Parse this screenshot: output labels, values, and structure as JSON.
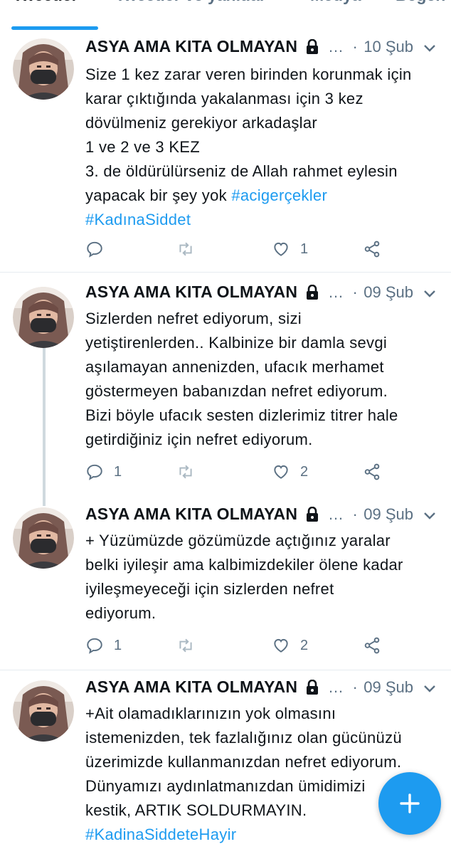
{
  "tabs": [
    {
      "label": "Tweetler",
      "active": true
    },
    {
      "label": "Tweetler ve yanıtlar",
      "active": false
    },
    {
      "label": "Medya",
      "active": false
    },
    {
      "label": "Beğen",
      "active": false
    }
  ],
  "colors": {
    "accent": "#1d9bf0",
    "muted": "#5b7083",
    "text": "#0f1419",
    "divider": "#e6ecf0"
  },
  "tweets": [
    {
      "author": "ASYA AMA KITA OLMAYAN",
      "protected_icon": "lock-icon",
      "ellipsis": "…",
      "separator": "·",
      "date": "10 Şub",
      "lines": [
        "Size 1 kez zarar veren birinden korunmak için",
        "karar çıktığında yakalanması için 3 kez",
        "dövülmeniz gerekiyor arkadaşlar",
        "1 ve 2 ve 3 KEZ",
        "3. de öldürülürseniz de Allah rahmet eylesin",
        "yapacak bir şey yok"
      ],
      "hashtag_inline": "#acigerçekler",
      "hashtag_line": "#KadınaSiddet",
      "reply_count": "",
      "retweet_count": "",
      "like_count": "1"
    },
    {
      "author": "ASYA AMA KITA OLMAYAN",
      "protected_icon": "lock-icon",
      "ellipsis": "…",
      "separator": "·",
      "date": "09 Şub",
      "lines": [
        "Sizlerden nefret ediyorum, sizi",
        "yetiştirenlerden.. Kalbinize bir damla sevgi",
        "aşılamayan annenizden, ufacık merhamet",
        "göstermeyen babanızdan nefret ediyorum.",
        "Bizi böyle ufacık sesten dizlerimiz titrer hale",
        "getirdiğiniz için nefret ediyorum."
      ],
      "reply_count": "1",
      "retweet_count": "",
      "like_count": "2"
    },
    {
      "author": "ASYA AMA KITA OLMAYAN",
      "protected_icon": "lock-icon",
      "ellipsis": "…",
      "separator": "·",
      "date": "09 Şub",
      "lines": [
        "+ Yüzümüzde gözümüzde açtığınız yaralar",
        "belki iyileşir ama kalbimizdekiler ölene kadar",
        "iyileşmeyeceği için sizlerden nefret",
        "ediyorum."
      ],
      "reply_count": "1",
      "retweet_count": "",
      "like_count": "2"
    },
    {
      "author": "ASYA AMA KITA OLMAYAN",
      "protected_icon": "lock-icon",
      "ellipsis": "…",
      "separator": "·",
      "date": "09 Şub",
      "lines": [
        "+Ait olamadıklarınızın yok olmasını",
        "istemenizden, tek fazlalığınız olan gücünüzü",
        "üzerimizde kullanmanızdan nefret ediyorum.",
        "Dünyamızı aydınlatmanızdan ümidimizi",
        "kestik, ARTIK SOLDURMAYIN."
      ],
      "hashtag_line": "#KadinaSiddeteHayir"
    }
  ],
  "fab": {
    "icon": "plus-icon"
  }
}
